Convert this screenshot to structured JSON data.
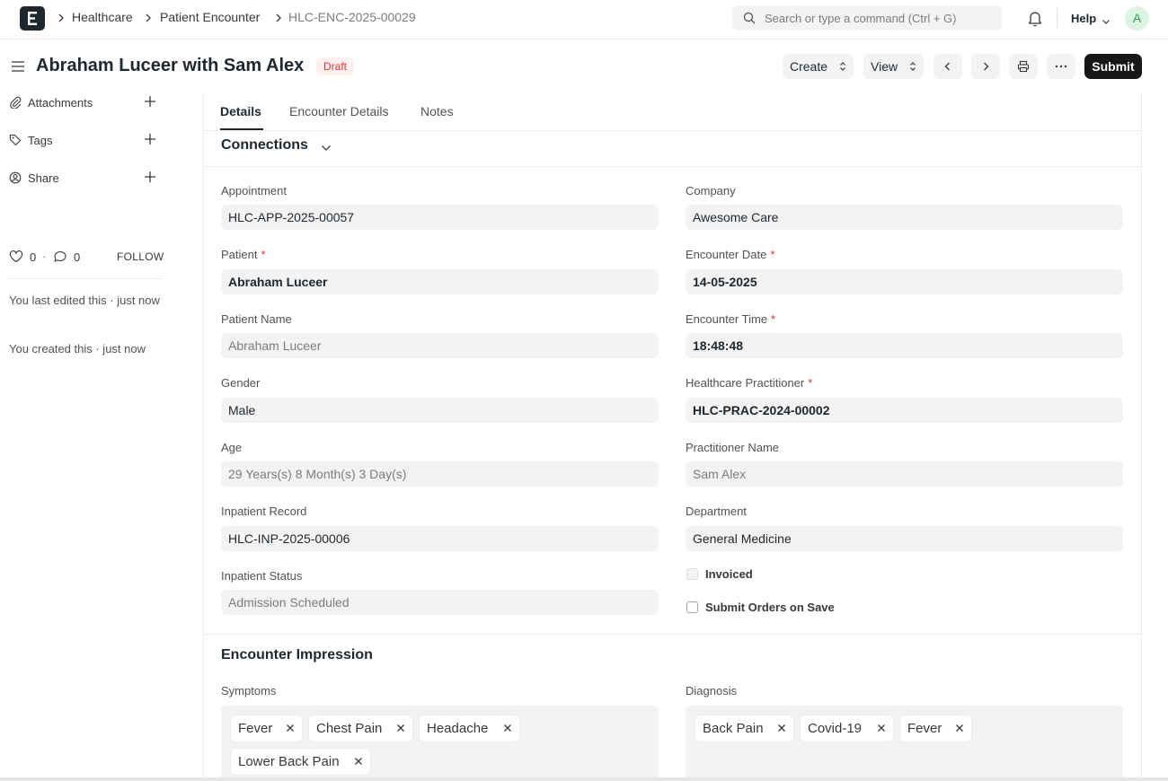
{
  "breadcrumbs": [
    "Healthcare",
    "Patient Encounter",
    "HLC-ENC-2025-00029"
  ],
  "search": {
    "placeholder": "Search or type a command (Ctrl + G)"
  },
  "navbar": {
    "help_label": "Help",
    "avatar_initial": "A"
  },
  "page": {
    "title": "Abraham Luceer with Sam Alex",
    "status": "Draft",
    "buttons": {
      "create": "Create",
      "view": "View",
      "submit": "Submit"
    }
  },
  "sidebar": {
    "items": [
      {
        "label": "Attachments",
        "icon": "paperclip-icon"
      },
      {
        "label": "Tags",
        "icon": "tag-icon"
      },
      {
        "label": "Share",
        "icon": "share-user-icon"
      }
    ],
    "likes": "0",
    "comments": "0",
    "follow_label": "FOLLOW",
    "edited_note": "You last edited this · just now",
    "created_note": "You created this · just now"
  },
  "tabs": [
    "Details",
    "Encounter Details",
    "Notes"
  ],
  "sections": {
    "connections": "Connections",
    "impression": "Encounter Impression"
  },
  "fields": {
    "appointment": {
      "label": "Appointment",
      "value": "HLC-APP-2025-00057"
    },
    "company": {
      "label": "Company",
      "value": "Awesome Care"
    },
    "patient": {
      "label": "Patient",
      "value": "Abraham Luceer"
    },
    "encounter_date": {
      "label": "Encounter Date",
      "value": "14-05-2025"
    },
    "patient_name": {
      "label": "Patient Name",
      "value": "Abraham Luceer"
    },
    "encounter_time": {
      "label": "Encounter Time",
      "value": "18:48:48"
    },
    "gender": {
      "label": "Gender",
      "value": "Male"
    },
    "practitioner": {
      "label": "Healthcare Practitioner",
      "value": "HLC-PRAC-2024-00002"
    },
    "age": {
      "label": "Age",
      "value": "29 Years(s) 8 Month(s) 3 Day(s)"
    },
    "practitioner_name": {
      "label": "Practitioner Name",
      "value": "Sam Alex"
    },
    "inpatient_record": {
      "label": "Inpatient Record",
      "value": "HLC-INP-2025-00006"
    },
    "department": {
      "label": "Department",
      "value": "General Medicine"
    },
    "inpatient_status": {
      "label": "Inpatient Status",
      "value": "Admission Scheduled"
    },
    "invoiced": {
      "label": "Invoiced",
      "checked": false
    },
    "submit_orders": {
      "label": "Submit Orders on Save",
      "checked": false
    }
  },
  "impression": {
    "symptoms_label": "Symptoms",
    "symptoms": [
      "Fever",
      "Chest Pain",
      "Headache",
      "Lower Back Pain"
    ],
    "diagnosis_label": "Diagnosis",
    "diagnosis": [
      "Back Pain",
      "Covid-19",
      "Fever"
    ]
  }
}
